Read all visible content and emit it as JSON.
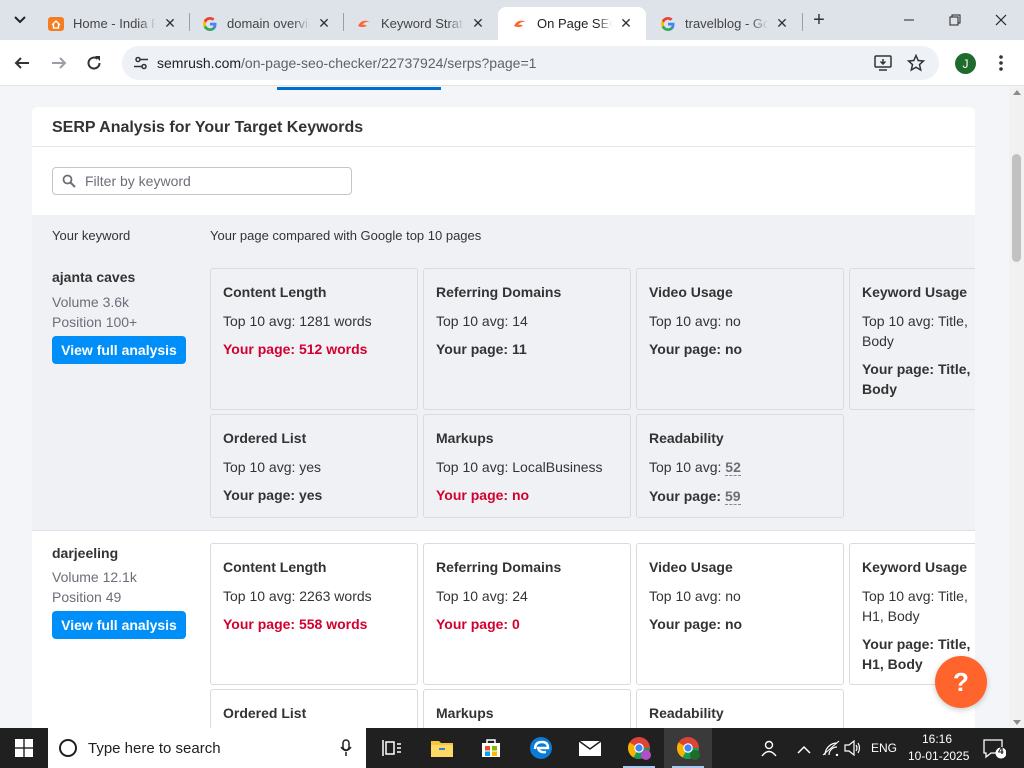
{
  "browser": {
    "tabs": [
      {
        "title": "Home - India F",
        "icon": "orange-home-icon",
        "active": false
      },
      {
        "title": "domain overvie",
        "icon": "google-icon",
        "active": false
      },
      {
        "title": "Keyword Strate",
        "icon": "semrush-icon",
        "active": false
      },
      {
        "title": "On Page SEO C",
        "icon": "semrush-icon",
        "active": true
      },
      {
        "title": "travelblog - Go",
        "icon": "google-icon",
        "active": false
      }
    ],
    "url_host": "semrush.com",
    "url_path": "/on-page-seo-checker/22737924/serps?page=1",
    "profile_initial": "J"
  },
  "panel": {
    "title": "SERP Analysis for Your Target Keywords",
    "filter_placeholder": "Filter by keyword",
    "col_keyword": "Your keyword",
    "col_compare": "Your page compared with Google top 10 pages"
  },
  "keywords": [
    {
      "name": "ajanta caves",
      "volume": "Volume 3.6k",
      "position": "Position 100+",
      "button": "View full analysis",
      "cards": {
        "content_length": {
          "title": "Content Length",
          "top": "Top 10 avg: 1281 words",
          "yours": "Your page: 512 words"
        },
        "referring_domains": {
          "title": "Referring Domains",
          "top": "Top 10 avg: 14",
          "yours": "Your page: 11"
        },
        "video_usage": {
          "title": "Video Usage",
          "top": "Top 10 avg: no",
          "yours": "Your page: no"
        },
        "keyword_usage": {
          "title": "Keyword Usage",
          "top": "Top 10 avg: Title, Body",
          "yours": "Your page: Title, Body"
        },
        "ordered_list": {
          "title": "Ordered List",
          "top": "Top 10 avg: yes",
          "yours": "Your page: yes"
        },
        "markups": {
          "title": "Markups",
          "top": "Top 10 avg: LocalBusiness",
          "yours": "Your page: no"
        },
        "readability": {
          "title": "Readability",
          "top_label": "Top 10 avg:",
          "top_value": "52",
          "yours_label": "Your page:",
          "yours_value": "59"
        }
      }
    },
    {
      "name": "darjeeling",
      "volume": "Volume 12.1k",
      "position": "Position 49",
      "button": "View full analysis",
      "cards": {
        "content_length": {
          "title": "Content Length",
          "top": "Top 10 avg: 2263 words",
          "yours": "Your page: 558 words"
        },
        "referring_domains": {
          "title": "Referring Domains",
          "top": "Top 10 avg: 24",
          "yours": "Your page: 0"
        },
        "video_usage": {
          "title": "Video Usage",
          "top": "Top 10 avg: no",
          "yours": "Your page: no"
        },
        "keyword_usage": {
          "title": "Keyword Usage",
          "top": "Top 10 avg: Title, H1, Body",
          "yours": "Your page: Title, H1, Body"
        },
        "ordered_list": {
          "title": "Ordered List"
        },
        "markups": {
          "title": "Markups"
        },
        "readability": {
          "title": "Readability"
        }
      }
    }
  ],
  "help_button": "?",
  "taskbar": {
    "search_placeholder": "Type here to search",
    "language": "ENG",
    "time": "16:16",
    "date": "10-01-2025",
    "notification_count": "4"
  },
  "colors": {
    "accent_blue": "#008ff8",
    "alert_red": "#d1002f",
    "help_orange": "#ff642d"
  }
}
